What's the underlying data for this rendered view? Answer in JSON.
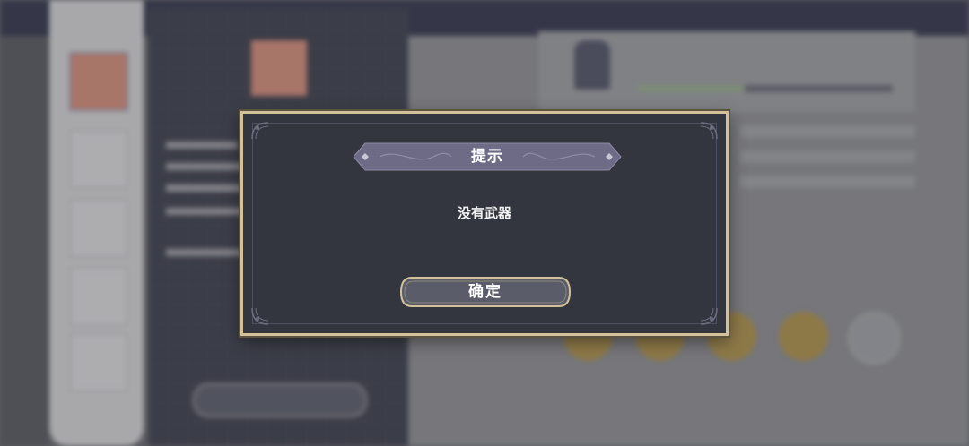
{
  "dialog": {
    "title": "提示",
    "message": "没有武器",
    "confirm_label": "确定"
  },
  "colors": {
    "dialog_bg": "#33353f",
    "dialog_border": "#d4c19a",
    "banner_fill": "#6d6b86",
    "button_fill": "#5a5c6a"
  },
  "icons": [
    "corner-ornament-icon",
    "diamond-icon"
  ]
}
